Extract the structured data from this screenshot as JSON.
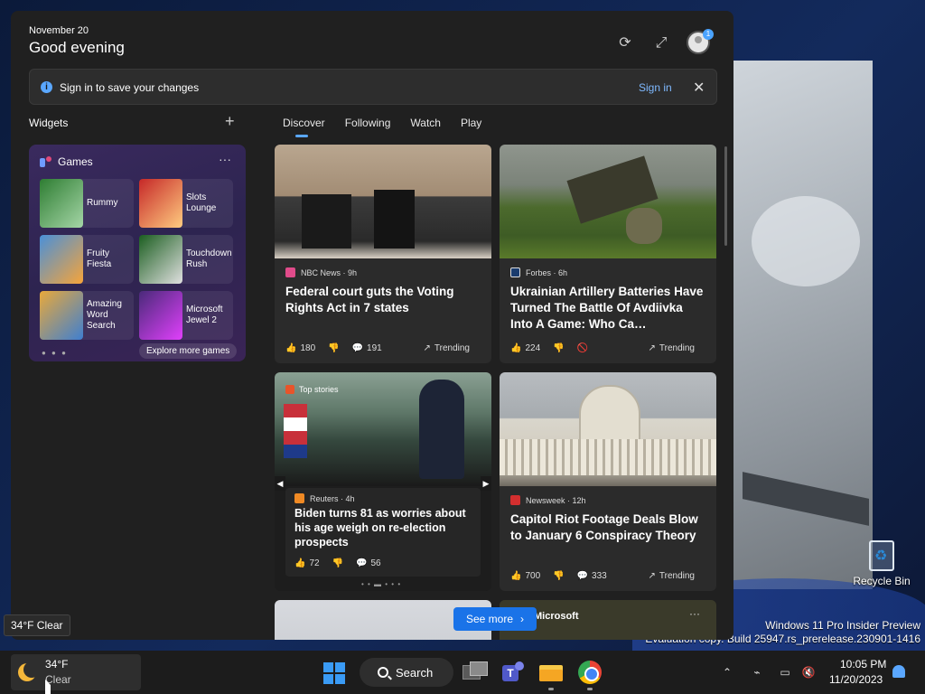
{
  "panel": {
    "date": "November 20",
    "greeting": "Good evening",
    "notification_count": "1"
  },
  "signin_bar": {
    "message": "Sign in to save your changes",
    "action": "Sign in"
  },
  "widgets": {
    "title": "Widgets"
  },
  "tabs": [
    {
      "label": "Discover",
      "active": true
    },
    {
      "label": "Following",
      "active": false
    },
    {
      "label": "Watch",
      "active": false
    },
    {
      "label": "Play",
      "active": false
    }
  ],
  "games": {
    "title": "Games",
    "items": [
      {
        "name": "Rummy",
        "color": "#2e7d32"
      },
      {
        "name": "Slots Lounge",
        "color": "#c62828"
      },
      {
        "name": "Fruity Fiesta",
        "color": "#4a90d9"
      },
      {
        "name": "Touchdown Rush",
        "color": "#1b5e20"
      },
      {
        "name": "Amazing Word Search",
        "color": "#e9a93b"
      },
      {
        "name": "Microsoft Jewel 2",
        "color": "#4a2a7a"
      }
    ],
    "explore": "Explore more games"
  },
  "news": [
    {
      "source": "NBC News · 9h",
      "source_color": "#e04b8a",
      "headline": "Federal court guts the Voting Rights Act in 7 states",
      "likes": "180",
      "comments": "191",
      "trend": "Trending"
    },
    {
      "source": "Forbes · 6h",
      "source_color": "#1a3c6e",
      "headline": "Ukrainian Artillery Batteries Have Turned The Battle Of Avdiivka Into A Game: Who Ca…",
      "likes": "224",
      "trend": "Trending"
    },
    {
      "label": "Top stories",
      "source": "Reuters · 4h",
      "source_color": "#f08a24",
      "headline": "Biden turns 81 as worries about his age weigh on re-election prospects",
      "likes": "72",
      "comments": "56"
    },
    {
      "source": "Newsweek · 12h",
      "source_color": "#d32f2f",
      "headline": "Capitol Riot Footage Deals Blow to January 6 Conspiracy Theory",
      "likes": "700",
      "comments": "333",
      "trend": "Trending"
    }
  ],
  "bottom_card": {
    "label": "Microsoft"
  },
  "see_more": "See more",
  "tooltip": "34°F Clear",
  "desktop": {
    "recycle_bin": "Recycle Bin",
    "watermark_line1": "Windows 11 Pro Insider Preview",
    "watermark_line2": "Evaluation copy. Build 25947.rs_prerelease.230901-1416"
  },
  "taskbar": {
    "weather_temp": "34°F",
    "weather_cond": "Clear",
    "search_label": "Search",
    "time": "10:05 PM",
    "date": "11/20/2023"
  }
}
